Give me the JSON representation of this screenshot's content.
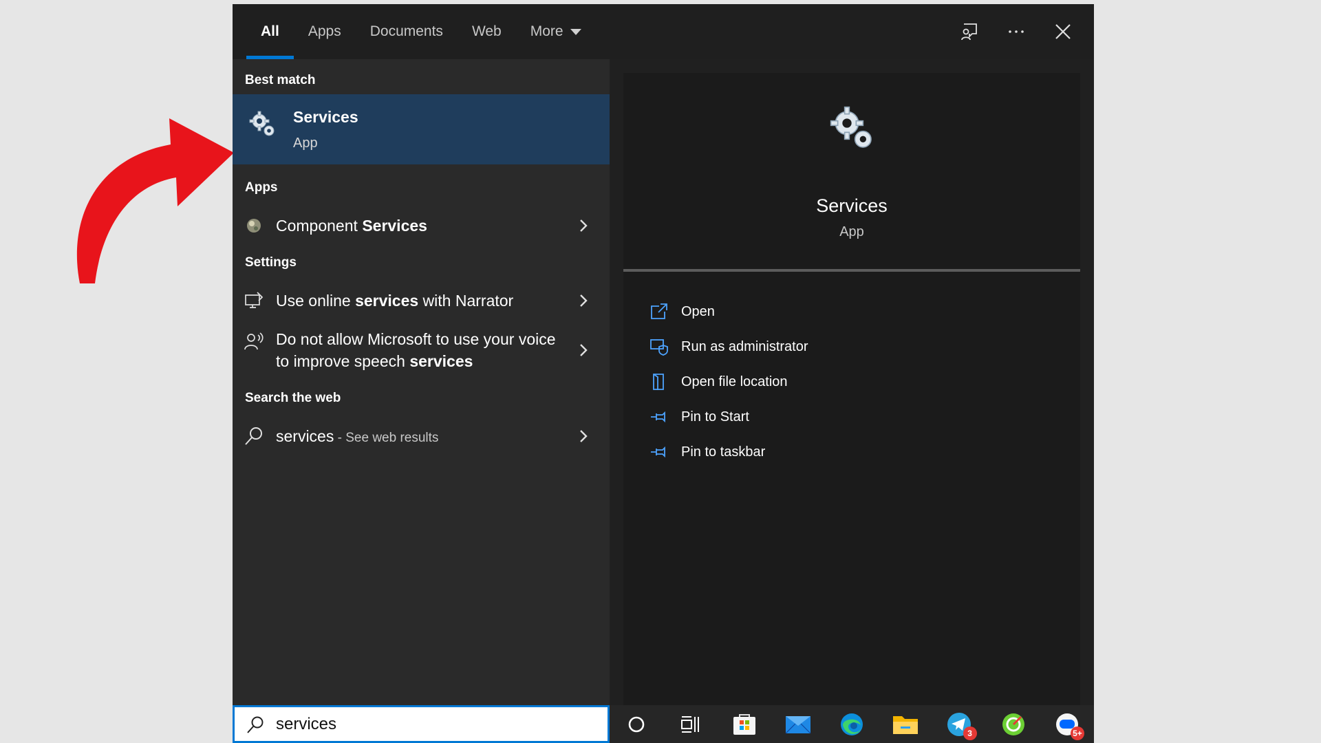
{
  "tabs": [
    {
      "label": "All"
    },
    {
      "label": "Apps"
    },
    {
      "label": "Documents"
    },
    {
      "label": "Web"
    },
    {
      "label": "More"
    }
  ],
  "left": {
    "best_match_header": "Best match",
    "best_match": {
      "title": "Services",
      "subtitle": "App"
    },
    "apps_header": "Apps",
    "apps": [
      {
        "pre": "Component ",
        "bold": "Services",
        "post": ""
      }
    ],
    "settings_header": "Settings",
    "settings": [
      {
        "pre": "Use online ",
        "bold": "services",
        "post": " with Narrator"
      },
      {
        "pre": "Do not allow Microsoft to use your voice to improve speech ",
        "bold": "services",
        "post": ""
      }
    ],
    "web_header": "Search the web",
    "web": {
      "query": "services",
      "suffix": " - See web results"
    }
  },
  "preview": {
    "title": "Services",
    "subtitle": "App",
    "actions": [
      {
        "label": "Open",
        "icon": "open-icon"
      },
      {
        "label": "Run as administrator",
        "icon": "shield-icon"
      },
      {
        "label": "Open file location",
        "icon": "folder-location-icon"
      },
      {
        "label": "Pin to Start",
        "icon": "pin-icon"
      },
      {
        "label": "Pin to taskbar",
        "icon": "pin-icon"
      }
    ]
  },
  "search": {
    "value": "services"
  },
  "taskbar": {
    "telegram_badge": "3",
    "zalo_badge": "5+"
  },
  "colors": {
    "accent": "#0078d4",
    "selected": "#1f3d5c",
    "arrow": "#e8141b"
  }
}
